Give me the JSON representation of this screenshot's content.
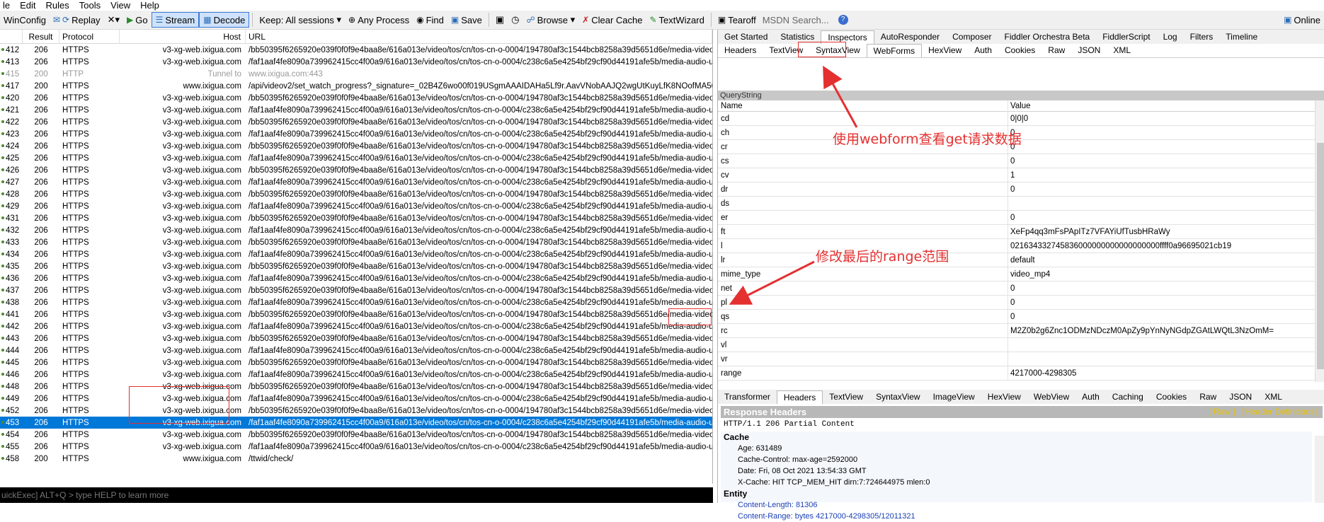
{
  "menu": [
    "le",
    "Edit",
    "Rules",
    "Tools",
    "View",
    "Help"
  ],
  "toolbar": {
    "winconfig": "WinConfig",
    "replay": "Replay",
    "go": "Go",
    "stream": "Stream",
    "decode": "Decode",
    "keep": "Keep: All sessions",
    "any_process": "Any Process",
    "find": "Find",
    "save": "Save",
    "browse": "Browse",
    "clear_cache": "Clear Cache",
    "textwizard": "TextWizard",
    "tearoff": "Tearoff",
    "msdn_placeholder": "MSDN Search...",
    "online": "Online"
  },
  "sessions": {
    "headers": {
      "result": "Result",
      "protocol": "Protocol",
      "host": "Host",
      "url": "URL"
    },
    "rows": [
      {
        "id": "412",
        "result": "206",
        "protocol": "HTTPS",
        "host": "v3-xg-web.ixigua.com",
        "url": "/bb50395f6265920e039f0f0f9e4baa8e/616a013e/video/tos/cn/tos-cn-o-0004/194780af3c1544bcb8258a39d5651d6e/media-video-av",
        "style": ""
      },
      {
        "id": "413",
        "result": "206",
        "protocol": "HTTPS",
        "host": "v3-xg-web.ixigua.com",
        "url": "/faf1aaf4fe8090a739962415cc4f00a9/616a013e/video/tos/cn/tos-cn-o-0004/c238c6a5e4254bf29cf90d44191afe5b/media-audio-und",
        "style": ""
      },
      {
        "id": "415",
        "result": "200",
        "protocol": "HTTP",
        "host": "Tunnel to",
        "url": "www.ixigua.com:443",
        "style": "tunnel"
      },
      {
        "id": "417",
        "result": "200",
        "protocol": "HTTPS",
        "host": "www.ixigua.com",
        "url": "/api/videov2/set_watch_progress?_signature=_02B4Z6wo00f019USgmAAAIDAHa5Lf9r.AavVNobAAJQ2wgUtKuyLfK8NOofMA56saiev",
        "style": ""
      },
      {
        "id": "420",
        "result": "206",
        "protocol": "HTTPS",
        "host": "v3-xg-web.ixigua.com",
        "url": "/bb50395f6265920e039f0f0f9e4baa8e/616a013e/video/tos/cn/tos-cn-o-0004/194780af3c1544bcb8258a39d5651d6e/media-video-av",
        "style": ""
      },
      {
        "id": "421",
        "result": "206",
        "protocol": "HTTPS",
        "host": "v3-xg-web.ixigua.com",
        "url": "/faf1aaf4fe8090a739962415cc4f00a9/616a013e/video/tos/cn/tos-cn-o-0004/c238c6a5e4254bf29cf90d44191afe5b/media-audio-und",
        "style": ""
      },
      {
        "id": "422",
        "result": "206",
        "protocol": "HTTPS",
        "host": "v3-xg-web.ixigua.com",
        "url": "/bb50395f6265920e039f0f0f9e4baa8e/616a013e/video/tos/cn/tos-cn-o-0004/194780af3c1544bcb8258a39d5651d6e/media-video-av",
        "style": ""
      },
      {
        "id": "423",
        "result": "206",
        "protocol": "HTTPS",
        "host": "v3-xg-web.ixigua.com",
        "url": "/faf1aaf4fe8090a739962415cc4f00a9/616a013e/video/tos/cn/tos-cn-o-0004/c238c6a5e4254bf29cf90d44191afe5b/media-audio-und",
        "style": ""
      },
      {
        "id": "424",
        "result": "206",
        "protocol": "HTTPS",
        "host": "v3-xg-web.ixigua.com",
        "url": "/bb50395f6265920e039f0f0f9e4baa8e/616a013e/video/tos/cn/tos-cn-o-0004/194780af3c1544bcb8258a39d5651d6e/media-video-av",
        "style": ""
      },
      {
        "id": "425",
        "result": "206",
        "protocol": "HTTPS",
        "host": "v3-xg-web.ixigua.com",
        "url": "/faf1aaf4fe8090a739962415cc4f00a9/616a013e/video/tos/cn/tos-cn-o-0004/c238c6a5e4254bf29cf90d44191afe5b/media-audio-und",
        "style": ""
      },
      {
        "id": "426",
        "result": "206",
        "protocol": "HTTPS",
        "host": "v3-xg-web.ixigua.com",
        "url": "/bb50395f6265920e039f0f0f9e4baa8e/616a013e/video/tos/cn/tos-cn-o-0004/194780af3c1544bcb8258a39d5651d6e/media-video-av",
        "style": ""
      },
      {
        "id": "427",
        "result": "206",
        "protocol": "HTTPS",
        "host": "v3-xg-web.ixigua.com",
        "url": "/faf1aaf4fe8090a739962415cc4f00a9/616a013e/video/tos/cn/tos-cn-o-0004/c238c6a5e4254bf29cf90d44191afe5b/media-audio-und",
        "style": ""
      },
      {
        "id": "428",
        "result": "206",
        "protocol": "HTTPS",
        "host": "v3-xg-web.ixigua.com",
        "url": "/bb50395f6265920e039f0f0f9e4baa8e/616a013e/video/tos/cn/tos-cn-o-0004/194780af3c1544bcb8258a39d5651d6e/media-video-av",
        "style": ""
      },
      {
        "id": "429",
        "result": "206",
        "protocol": "HTTPS",
        "host": "v3-xg-web.ixigua.com",
        "url": "/faf1aaf4fe8090a739962415cc4f00a9/616a013e/video/tos/cn/tos-cn-o-0004/c238c6a5e4254bf29cf90d44191afe5b/media-audio-und",
        "style": ""
      },
      {
        "id": "431",
        "result": "206",
        "protocol": "HTTPS",
        "host": "v3-xg-web.ixigua.com",
        "url": "/bb50395f6265920e039f0f0f9e4baa8e/616a013e/video/tos/cn/tos-cn-o-0004/194780af3c1544bcb8258a39d5651d6e/media-video-av",
        "style": ""
      },
      {
        "id": "432",
        "result": "206",
        "protocol": "HTTPS",
        "host": "v3-xg-web.ixigua.com",
        "url": "/faf1aaf4fe8090a739962415cc4f00a9/616a013e/video/tos/cn/tos-cn-o-0004/c238c6a5e4254bf29cf90d44191afe5b/media-audio-und",
        "style": ""
      },
      {
        "id": "433",
        "result": "206",
        "protocol": "HTTPS",
        "host": "v3-xg-web.ixigua.com",
        "url": "/bb50395f6265920e039f0f0f9e4baa8e/616a013e/video/tos/cn/tos-cn-o-0004/194780af3c1544bcb8258a39d5651d6e/media-video-av",
        "style": ""
      },
      {
        "id": "434",
        "result": "206",
        "protocol": "HTTPS",
        "host": "v3-xg-web.ixigua.com",
        "url": "/faf1aaf4fe8090a739962415cc4f00a9/616a013e/video/tos/cn/tos-cn-o-0004/c238c6a5e4254bf29cf90d44191afe5b/media-audio-und",
        "style": ""
      },
      {
        "id": "435",
        "result": "206",
        "protocol": "HTTPS",
        "host": "v3-xg-web.ixigua.com",
        "url": "/bb50395f6265920e039f0f0f9e4baa8e/616a013e/video/tos/cn/tos-cn-o-0004/194780af3c1544bcb8258a39d5651d6e/media-video-av",
        "style": ""
      },
      {
        "id": "436",
        "result": "206",
        "protocol": "HTTPS",
        "host": "v3-xg-web.ixigua.com",
        "url": "/faf1aaf4fe8090a739962415cc4f00a9/616a013e/video/tos/cn/tos-cn-o-0004/c238c6a5e4254bf29cf90d44191afe5b/media-audio-und",
        "style": ""
      },
      {
        "id": "437",
        "result": "206",
        "protocol": "HTTPS",
        "host": "v3-xg-web.ixigua.com",
        "url": "/bb50395f6265920e039f0f0f9e4baa8e/616a013e/video/tos/cn/tos-cn-o-0004/194780af3c1544bcb8258a39d5651d6e/media-video-av",
        "style": ""
      },
      {
        "id": "438",
        "result": "206",
        "protocol": "HTTPS",
        "host": "v3-xg-web.ixigua.com",
        "url": "/faf1aaf4fe8090a739962415cc4f00a9/616a013e/video/tos/cn/tos-cn-o-0004/c238c6a5e4254bf29cf90d44191afe5b/media-audio-und",
        "style": ""
      },
      {
        "id": "441",
        "result": "206",
        "protocol": "HTTPS",
        "host": "v3-xg-web.ixigua.com",
        "url": "/bb50395f6265920e039f0f0f9e4baa8e/616a013e/video/tos/cn/tos-cn-o-0004/194780af3c1544bcb8258a39d5651d6e/media-video-av",
        "style": ""
      },
      {
        "id": "442",
        "result": "206",
        "protocol": "HTTPS",
        "host": "v3-xg-web.ixigua.com",
        "url": "/faf1aaf4fe8090a739962415cc4f00a9/616a013e/video/tos/cn/tos-cn-o-0004/c238c6a5e4254bf29cf90d44191afe5b/media-audio-und",
        "style": ""
      },
      {
        "id": "443",
        "result": "206",
        "protocol": "HTTPS",
        "host": "v3-xg-web.ixigua.com",
        "url": "/bb50395f6265920e039f0f0f9e4baa8e/616a013e/video/tos/cn/tos-cn-o-0004/194780af3c1544bcb8258a39d5651d6e/media-video-av",
        "style": ""
      },
      {
        "id": "444",
        "result": "206",
        "protocol": "HTTPS",
        "host": "v3-xg-web.ixigua.com",
        "url": "/faf1aaf4fe8090a739962415cc4f00a9/616a013e/video/tos/cn/tos-cn-o-0004/c238c6a5e4254bf29cf90d44191afe5b/media-audio-und",
        "style": ""
      },
      {
        "id": "445",
        "result": "206",
        "protocol": "HTTPS",
        "host": "v3-xg-web.ixigua.com",
        "url": "/bb50395f6265920e039f0f0f9e4baa8e/616a013e/video/tos/cn/tos-cn-o-0004/194780af3c1544bcb8258a39d5651d6e/media-video-av",
        "style": ""
      },
      {
        "id": "446",
        "result": "206",
        "protocol": "HTTPS",
        "host": "v3-xg-web.ixigua.com",
        "url": "/faf1aaf4fe8090a739962415cc4f00a9/616a013e/video/tos/cn/tos-cn-o-0004/c238c6a5e4254bf29cf90d44191afe5b/media-audio-und",
        "style": ""
      },
      {
        "id": "448",
        "result": "206",
        "protocol": "HTTPS",
        "host": "v3-xg-web.ixigua.com",
        "url": "/bb50395f6265920e039f0f0f9e4baa8e/616a013e/video/tos/cn/tos-cn-o-0004/194780af3c1544bcb8258a39d5651d6e/media-video-av",
        "style": ""
      },
      {
        "id": "449",
        "result": "206",
        "protocol": "HTTPS",
        "host": "v3-xg-web.ixigua.com",
        "url": "/faf1aaf4fe8090a739962415cc4f00a9/616a013e/video/tos/cn/tos-cn-o-0004/c238c6a5e4254bf29cf90d44191afe5b/media-audio-und",
        "style": ""
      },
      {
        "id": "452",
        "result": "206",
        "protocol": "HTTPS",
        "host": "v3-xg-web.ixigua.com",
        "url": "/bb50395f6265920e039f0f0f9e4baa8e/616a013e/video/tos/cn/tos-cn-o-0004/194780af3c1544bcb8258a39d5651d6e/media-video-av",
        "style": ""
      },
      {
        "id": "453",
        "result": "206",
        "protocol": "HTTPS",
        "host": "v3-xg-web.ixigua.com",
        "url": "/faf1aaf4fe8090a739962415cc4f00a9/616a013e/video/tos/cn/tos-cn-o-0004/c238c6a5e4254bf29cf90d44191afe5b/media-audio-und",
        "style": "sel"
      },
      {
        "id": "454",
        "result": "206",
        "protocol": "HTTPS",
        "host": "v3-xg-web.ixigua.com",
        "url": "/bb50395f6265920e039f0f0f9e4baa8e/616a013e/video/tos/cn/tos-cn-o-0004/194780af3c1544bcb8258a39d5651d6e/media-video-av",
        "style": ""
      },
      {
        "id": "455",
        "result": "206",
        "protocol": "HTTPS",
        "host": "v3-xg-web.ixigua.com",
        "url": "/faf1aaf4fe8090a739962415cc4f00a9/616a013e/video/tos/cn/tos-cn-o-0004/c238c6a5e4254bf29cf90d44191afe5b/media-audio-und",
        "style": ""
      },
      {
        "id": "458",
        "result": "200",
        "protocol": "HTTPS",
        "host": "www.ixigua.com",
        "url": "/ttwid/check/",
        "style": ""
      }
    ]
  },
  "quickexec": "uickExec] ALT+Q > type HELP to learn more",
  "inspector": {
    "main_tabs": [
      "Get Started",
      "Statistics",
      "Inspectors",
      "AutoResponder",
      "Composer",
      "Fiddler Orchestra Beta",
      "FiddlerScript",
      "Log",
      "Filters",
      "Timeline"
    ],
    "request_tabs": [
      "Headers",
      "TextView",
      "SyntaxView",
      "WebForms",
      "HexView",
      "Auth",
      "Cookies",
      "Raw",
      "JSON",
      "XML"
    ],
    "querystring_title": "QueryString",
    "grid_headers": {
      "name": "Name",
      "value": "Value"
    },
    "params": [
      {
        "name": "cd",
        "value": "0|0|0"
      },
      {
        "name": "ch",
        "value": "0"
      },
      {
        "name": "cr",
        "value": "0"
      },
      {
        "name": "cs",
        "value": "0"
      },
      {
        "name": "cv",
        "value": "1"
      },
      {
        "name": "dr",
        "value": "0"
      },
      {
        "name": "ds",
        "value": ""
      },
      {
        "name": "er",
        "value": "0"
      },
      {
        "name": "ft",
        "value": "XeFp4qq3mFsPApITz7VFAYiUfTusbHRaWy"
      },
      {
        "name": "l",
        "value": "021634332745836000000000000000000ffff0a96695021cb19"
      },
      {
        "name": "lr",
        "value": "default"
      },
      {
        "name": "mime_type",
        "value": "video_mp4"
      },
      {
        "name": "net",
        "value": "0"
      },
      {
        "name": "pl",
        "value": "0"
      },
      {
        "name": "qs",
        "value": "0"
      },
      {
        "name": "rc",
        "value": "M2Z0b2g6Znc1ODMzNDczM0ApZy9pYnNyNGdpZGAtLWQtL3NzOmM="
      },
      {
        "name": "vl",
        "value": ""
      },
      {
        "name": "vr",
        "value": ""
      },
      {
        "name": "range",
        "value": "4217000-4298305"
      }
    ],
    "response_tabs": [
      "Transformer",
      "Headers",
      "TextView",
      "SyntaxView",
      "ImageView",
      "HexView",
      "WebView",
      "Auth",
      "Caching",
      "Cookies",
      "Raw",
      "JSON",
      "XML"
    ],
    "response": {
      "title": "Response Headers",
      "raw_link": "[ Raw ]",
      "defs_link": "[Header Definitions]",
      "status": "HTTP/1.1 206 Partial Content",
      "cache_title": "Cache",
      "cache": [
        "Age: 631489",
        "Cache-Control: max-age=2592000",
        "Date: Fri, 08 Oct 2021 13:54:33 GMT",
        "X-Cache: HIT TCP_MEM_HIT dirn:7:724644975 mlen:0"
      ],
      "entity_title": "Entity",
      "entity": [
        "Content-Length: 81306",
        "Content-Range: bytes 4217000-4298305/12011321"
      ]
    }
  },
  "annotations": {
    "webform_note": "使用webform查看get请求数据",
    "range_note": "修改最后的range范围"
  },
  "colors": {
    "selection": "#0078d7",
    "annotation": "#e53030",
    "link_blue": "#1a3fb5"
  }
}
